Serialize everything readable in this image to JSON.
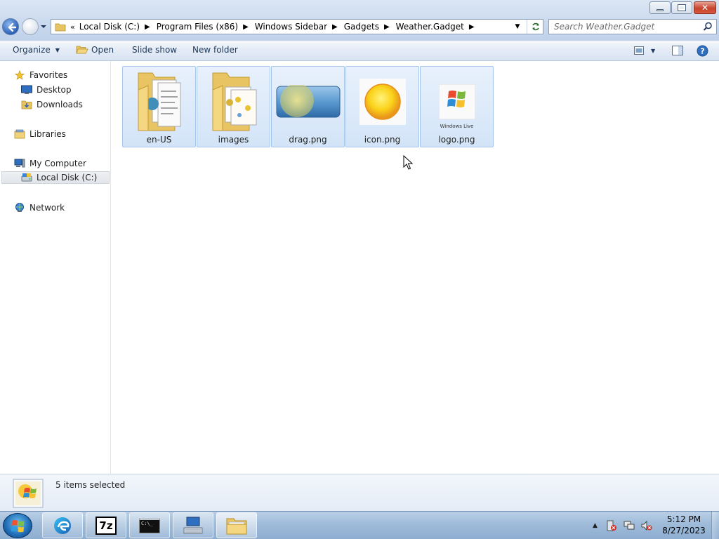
{
  "window": {
    "controls": [
      "minimize",
      "maximize",
      "close"
    ]
  },
  "address": {
    "overflow": "«",
    "crumbs": [
      "Local Disk (C:)",
      "Program Files (x86)",
      "Windows Sidebar",
      "Gadgets",
      "Weather.Gadget"
    ]
  },
  "search": {
    "placeholder": "Search Weather.Gadget"
  },
  "toolbar": {
    "organize": "Organize",
    "open": "Open",
    "slideshow": "Slide show",
    "new_folder": "New folder"
  },
  "navpane": {
    "favorites": "Favorites",
    "desktop": "Desktop",
    "downloads": "Downloads",
    "libraries": "Libraries",
    "computer": "My Computer",
    "local_disk": "Local Disk (C:)",
    "network": "Network"
  },
  "files": [
    {
      "name": "en-US",
      "type": "folder",
      "selected": true
    },
    {
      "name": "images",
      "type": "folder",
      "selected": true
    },
    {
      "name": "drag.png",
      "type": "image",
      "selected": true
    },
    {
      "name": "icon.png",
      "type": "image",
      "selected": true
    },
    {
      "name": "logo.png",
      "type": "image",
      "selected": true
    }
  ],
  "logo_text": "Windows Live",
  "details": {
    "status": "5 items selected"
  },
  "taskbar": {
    "apps": [
      "edge-icon",
      "7zip-icon",
      "cmd-icon",
      "network-icon",
      "explorer-icon"
    ],
    "sevenzip_label": "7z",
    "clock_time": "5:12 PM",
    "clock_date": "8/27/2023"
  }
}
